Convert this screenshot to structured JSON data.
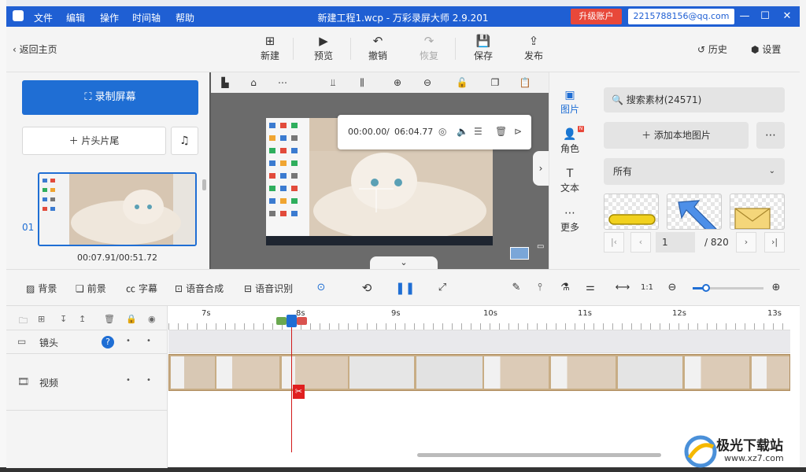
{
  "titlebar": {
    "menu": [
      "文件",
      "编辑",
      "操作",
      "时间轴",
      "帮助"
    ],
    "title": "新建工程1.wcp - 万彩录屏大师 2.9.201",
    "upgrade": "升级账户",
    "account": "2215788156@qq.com"
  },
  "toolbar": {
    "back": "返回主页",
    "new": "新建",
    "preview": "预览",
    "undo": "撤销",
    "redo": "恢复",
    "save": "保存",
    "publish": "发布",
    "history": "历史",
    "settings": "设置"
  },
  "left": {
    "record": "录制屏幕",
    "intro_outro": "片头片尾",
    "clip_number": "01",
    "clip_time": "00:07.91/00:51.72"
  },
  "preview": {
    "current_time": "00:00.00",
    "separator": "/",
    "total_time": "06:04.77"
  },
  "sidetabs": [
    {
      "label": "图片",
      "icon": "image-icon"
    },
    {
      "label": "角色",
      "icon": "person-icon"
    },
    {
      "label": "文本",
      "icon": "text-icon"
    },
    {
      "label": "更多",
      "icon": "more-icon"
    }
  ],
  "assets": {
    "search_placeholder": "搜索素材(24571)",
    "add_local": "添加本地图片",
    "filter_value": "所有",
    "page_current": "1",
    "page_total": "/ 820"
  },
  "tltool": {
    "background": "背景",
    "foreground": "前景",
    "subtitle": "字幕",
    "tts": "语音合成",
    "asr": "语音识别"
  },
  "timeline": {
    "ticks": [
      "7s",
      "8s",
      "9s",
      "10s",
      "11s",
      "12s",
      "13s"
    ],
    "tracks": [
      {
        "name": "镜头",
        "icon": "camera-icon"
      },
      {
        "name": "视频",
        "icon": "film-icon"
      }
    ]
  },
  "watermark": {
    "text": "极光下载站",
    "url": "www.xz7.com"
  },
  "colors": {
    "accent": "#1f6ed4",
    "titlebar": "#1f5fd3",
    "upgrade": "#e8483a",
    "playhead": "#d21a1a"
  }
}
